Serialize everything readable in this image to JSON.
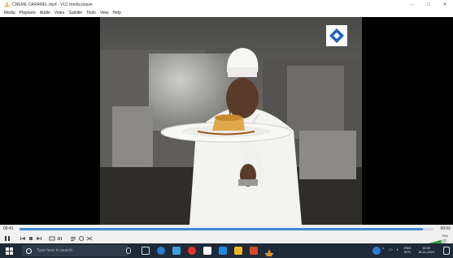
{
  "window": {
    "title": "CREME CARAMEL.mp4 - VLC media player",
    "minimize_glyph": "–",
    "maximize_glyph": "□",
    "close_glyph": "✕"
  },
  "menu": [
    "Media",
    "Playback",
    "Audio",
    "Video",
    "Subtitle",
    "Tools",
    "View",
    "Help"
  ],
  "player": {
    "time_elapsed": "09:41",
    "time_total": "09:55",
    "progress": 0.975,
    "volume_label": "75%",
    "volume_level": 0.75,
    "accent": "#3b8ad6"
  },
  "controls": {
    "play_pause_icon": "pause-icon",
    "prev_icon": "previous-icon",
    "stop_icon": "stop-icon",
    "next_icon": "next-icon",
    "fullscreen_icon": "fullscreen-icon",
    "extended_icon": "extended-settings-icon",
    "playlist_icon": "playlist-icon",
    "loop_icon": "loop-icon",
    "shuffle_icon": "shuffle-icon"
  },
  "taskbar": {
    "search_placeholder": "Type here to search",
    "tray_lang": "ENG",
    "tray_region": "INTL",
    "tray_time": "15:50",
    "tray_date": "18-11-2021"
  }
}
